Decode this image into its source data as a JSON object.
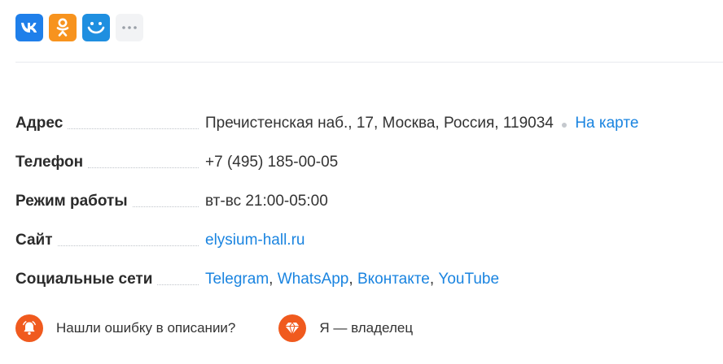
{
  "share": {
    "buttons": [
      {
        "name": "vk-share-button",
        "icon": "vk-icon",
        "color": "#1f7fea"
      },
      {
        "name": "ok-share-button",
        "icon": "odnoklassniki-icon",
        "color": "#f7931e"
      },
      {
        "name": "moimir-share-button",
        "icon": "smile-icon",
        "color": "#1f8fe0"
      },
      {
        "name": "more-share-button",
        "icon": "more-dots-icon",
        "color": "#f2f3f5"
      }
    ]
  },
  "info": {
    "address": {
      "label": "Адрес",
      "value": "Пречистенская наб., 17, Москва, Россия, 119034",
      "map_link": "На карте"
    },
    "phone": {
      "label": "Телефон",
      "value": "+7 (495) 185-00-05"
    },
    "hours": {
      "label": "Режим работы",
      "value": "вт-вс 21:00-05:00"
    },
    "site": {
      "label": "Сайт",
      "value": "elysium-hall.ru"
    },
    "social": {
      "label": "Социальные сети",
      "links": [
        "Telegram",
        "WhatsApp",
        "Вконтакте",
        "YouTube"
      ],
      "separator": ","
    }
  },
  "footer": {
    "report_error": "Нашли ошибку в описании?",
    "owner": "Я — владелец"
  },
  "colors": {
    "link": "#1a84e0",
    "accent_orange": "#f05a1e"
  }
}
